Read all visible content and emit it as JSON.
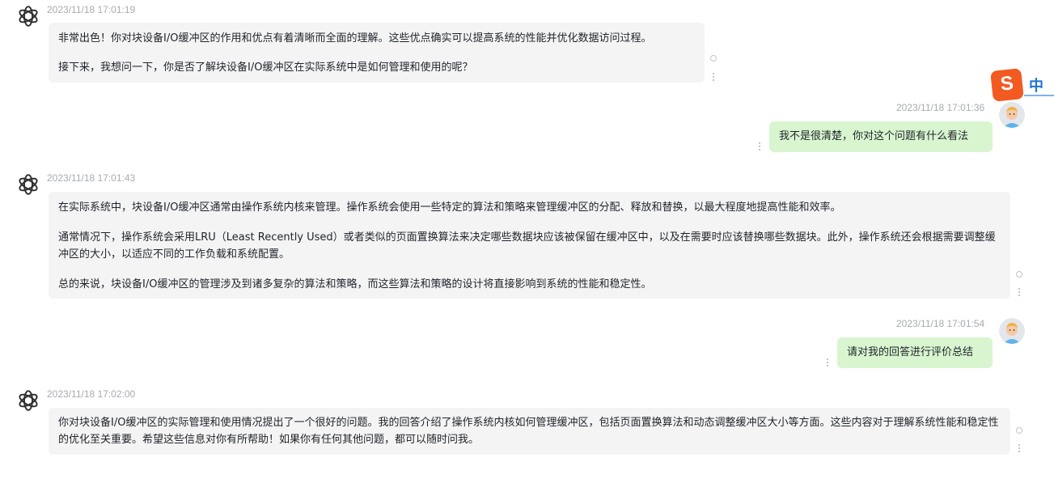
{
  "messages": [
    {
      "role": "assistant",
      "timestamp": "2023/11/18 17:01:19",
      "paragraphs": [
        "非常出色！你对块设备I/O缓冲区的作用和优点有着清晰而全面的理解。这些优点确实可以提高系统的性能并优化数据访问过程。",
        "接下来，我想问一下，你是否了解块设备I/O缓冲区在实际系统中是如何管理和使用的呢？"
      ]
    },
    {
      "role": "user",
      "timestamp": "2023/11/18 17:01:36",
      "text": "我不是很清楚，你对这个问题有什么看法"
    },
    {
      "role": "assistant",
      "timestamp": "2023/11/18 17:01:43",
      "paragraphs": [
        "在实际系统中，块设备I/O缓冲区通常由操作系统内核来管理。操作系统会使用一些特定的算法和策略来管理缓冲区的分配、释放和替换，以最大程度地提高性能和效率。",
        "通常情况下，操作系统会采用LRU（Least Recently Used）或者类似的页面置换算法来决定哪些数据块应该被保留在缓冲区中，以及在需要时应该替换哪些数据块。此外，操作系统还会根据需要调整缓冲区的大小，以适应不同的工作负载和系统配置。",
        "总的来说，块设备I/O缓冲区的管理涉及到诸多复杂的算法和策略，而这些算法和策略的设计将直接影响到系统的性能和稳定性。"
      ]
    },
    {
      "role": "user",
      "timestamp": "2023/11/18 17:01:54",
      "text": "请对我的回答进行评价总结"
    },
    {
      "role": "assistant",
      "timestamp": "2023/11/18 17:02:00",
      "paragraphs": [
        "你对块设备I/O缓冲区的实际管理和使用情况提出了一个很好的问题。我的回答介绍了操作系统内核如何管理缓冲区，包括页面置换算法和动态调整缓冲区大小等方面。这些内容对于理解系统性能和稳定性的优化至关重要。希望这些信息对你有所帮助！如果你有任何其他问题，都可以随时问我。"
      ]
    }
  ],
  "ime": {
    "logo": "S",
    "mode": "中"
  },
  "icons": {
    "assistant_avatar": "openai-logo-icon",
    "user_avatar": "user-avatar-icon",
    "status": "loading-ring-icon",
    "menu": "more-vertical-icon"
  },
  "colors": {
    "assistant_bubble": "#f4f4f5",
    "user_bubble": "#d8f5d0",
    "timestamp": "#a8abb2"
  }
}
